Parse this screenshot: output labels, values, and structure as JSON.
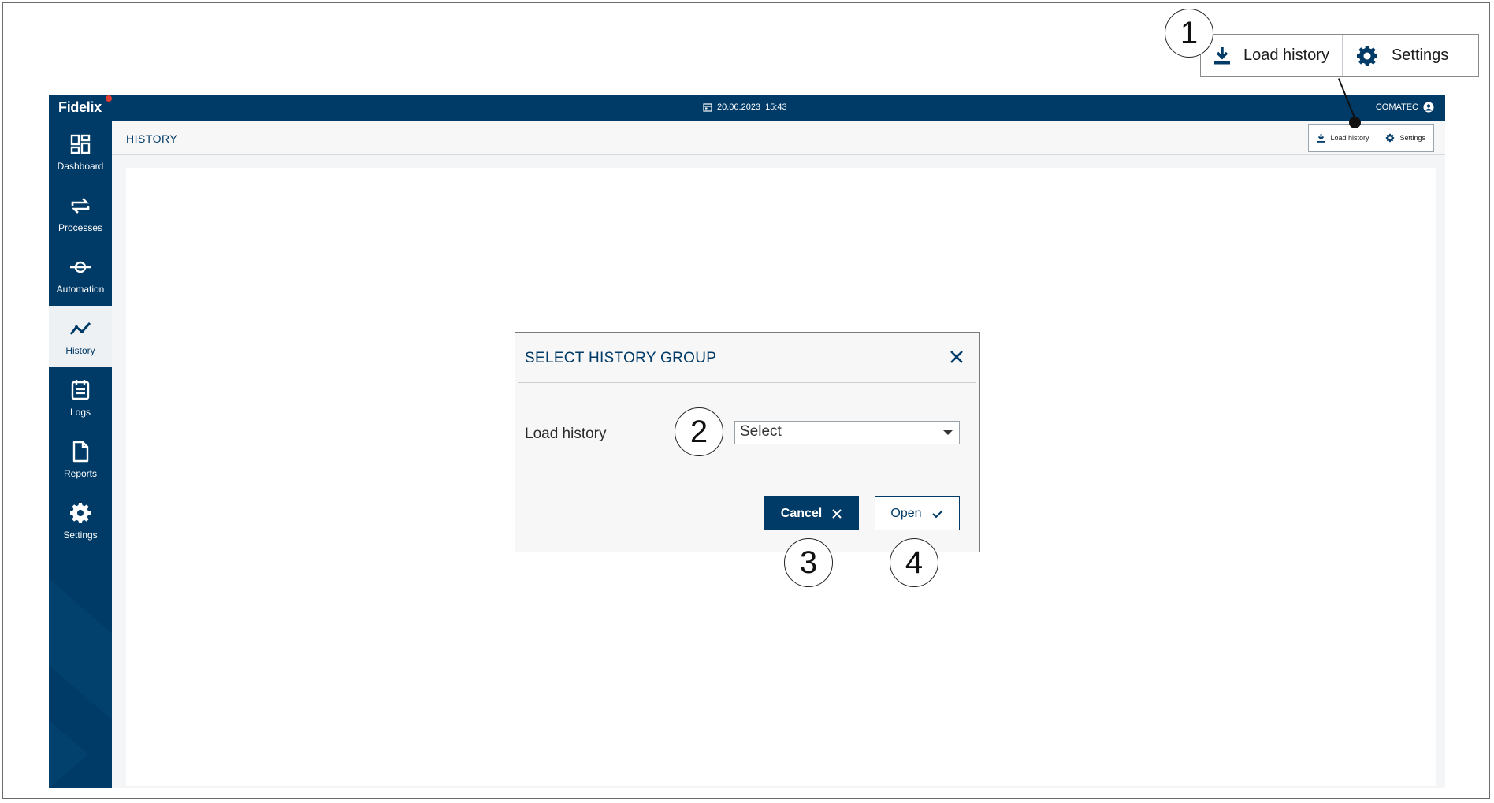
{
  "topbar": {
    "logo": "Fidelix",
    "date": "20.06.2023",
    "time": "15:43",
    "user": "COMATEC"
  },
  "sidebar": {
    "items": [
      {
        "label": "Dashboard",
        "icon": "dashboard-icon"
      },
      {
        "label": "Processes",
        "icon": "processes-icon"
      },
      {
        "label": "Automation",
        "icon": "automation-icon"
      },
      {
        "label": "History",
        "icon": "history-icon",
        "active": true
      },
      {
        "label": "Logs",
        "icon": "logs-icon"
      },
      {
        "label": "Reports",
        "icon": "reports-icon"
      },
      {
        "label": "Settings",
        "icon": "settings-icon"
      }
    ]
  },
  "header": {
    "title": "HISTORY",
    "toolbar": {
      "load_history_label": "Load history",
      "settings_label": "Settings"
    }
  },
  "dialog": {
    "title": "SELECT HISTORY GROUP",
    "field_label": "Load history",
    "select_value": "Select",
    "cancel_label": "Cancel",
    "open_label": "Open"
  },
  "callout": {
    "load_history_label": "Load history",
    "settings_label": "Settings"
  },
  "annotations": [
    "1",
    "2",
    "3",
    "4"
  ],
  "colors": {
    "brand_navy": "#003a66",
    "background": "#f4f5f6",
    "alert_dot": "#e23b2f"
  }
}
